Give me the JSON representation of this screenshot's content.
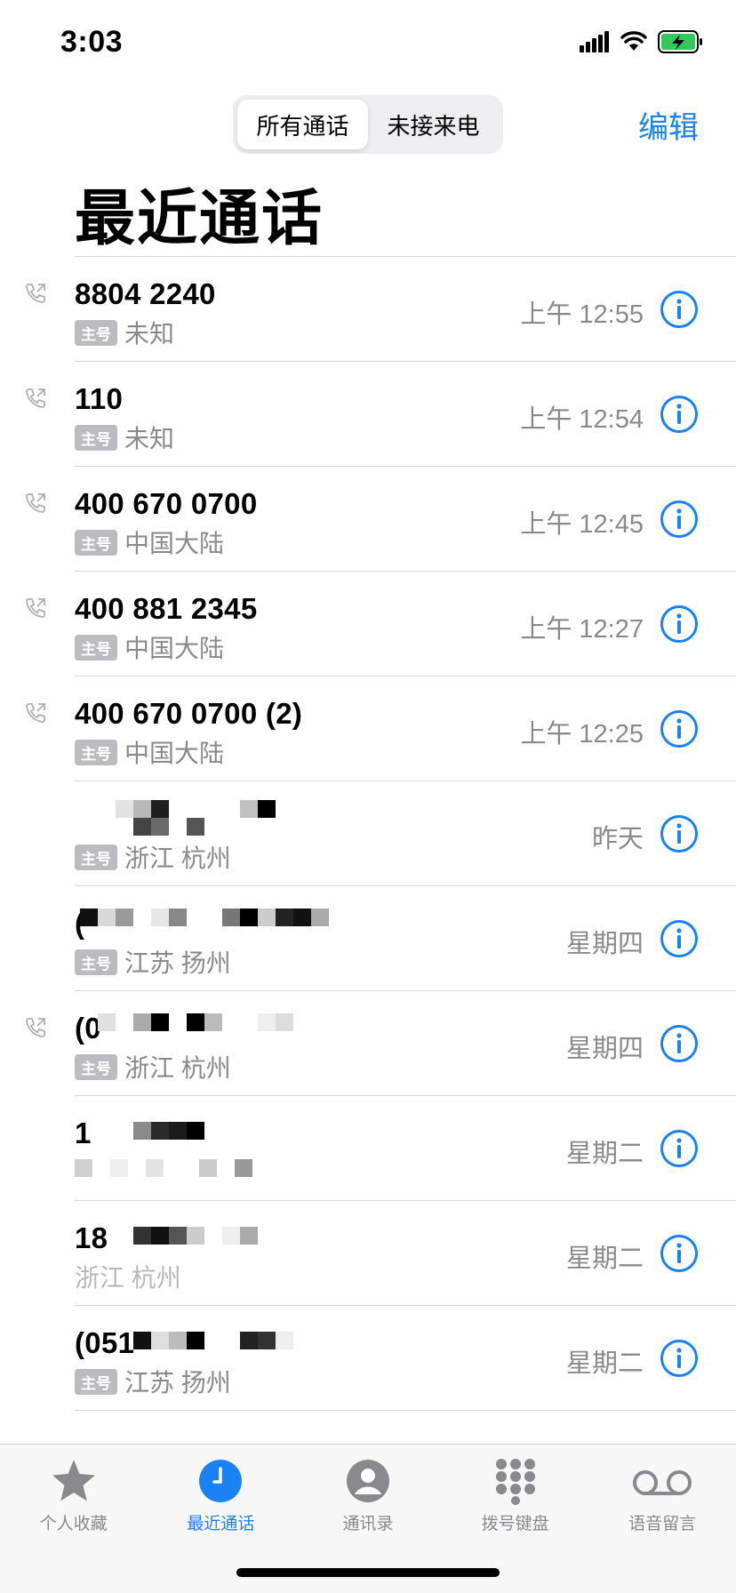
{
  "status": {
    "time": "3:03"
  },
  "nav": {
    "segments": [
      "所有通话",
      "未接来电"
    ],
    "active": 0,
    "edit_label": "编辑"
  },
  "title": "最近通话",
  "calls": [
    {
      "number": "8804 2240",
      "badge": "主号",
      "location": "未知",
      "time": "上午 12:55",
      "outgoing": true
    },
    {
      "number": "110",
      "badge": "主号",
      "location": "未知",
      "time": "上午 12:54",
      "outgoing": true
    },
    {
      "number": "400 670 0700",
      "badge": "主号",
      "location": "中国大陆",
      "time": "上午 12:45",
      "outgoing": true
    },
    {
      "number": "400 881 2345",
      "badge": "主号",
      "location": "中国大陆",
      "time": "上午 12:27",
      "outgoing": true
    },
    {
      "number": "400 670 0700 (2)",
      "badge": "主号",
      "location": "中国大陆",
      "time": "上午 12:25",
      "outgoing": true
    },
    {
      "number": "",
      "badge": "主号",
      "location": "浙江 杭州",
      "time": "昨天",
      "outgoing": false
    },
    {
      "number": "(",
      "badge": "主号",
      "location": "江苏 扬州",
      "time": "星期四",
      "outgoing": false
    },
    {
      "number": "(0",
      "badge": "主号",
      "location": "浙江 杭州",
      "time": "星期四",
      "outgoing": true
    },
    {
      "number": "1",
      "badge": "",
      "location": "",
      "time": "星期二",
      "outgoing": false
    },
    {
      "number": "18",
      "badge": "",
      "location": "浙江 杭州",
      "time": "星期二",
      "outgoing": false
    },
    {
      "number": "(051",
      "badge": "主号",
      "location": "江苏 扬州",
      "time": "星期二",
      "outgoing": false
    }
  ],
  "tabs": [
    {
      "label": "个人收藏",
      "icon": "star-icon"
    },
    {
      "label": "最近通话",
      "icon": "clock-icon",
      "active": true
    },
    {
      "label": "通讯录",
      "icon": "contact-icon"
    },
    {
      "label": "拨号键盘",
      "icon": "keypad-icon"
    },
    {
      "label": "语音留言",
      "icon": "voicemail-icon"
    }
  ],
  "colors": {
    "accent": "#1a82f5",
    "secondary_text": "#8a8a8e",
    "badge_bg": "#bcbcc0",
    "battery": "#34c759"
  }
}
